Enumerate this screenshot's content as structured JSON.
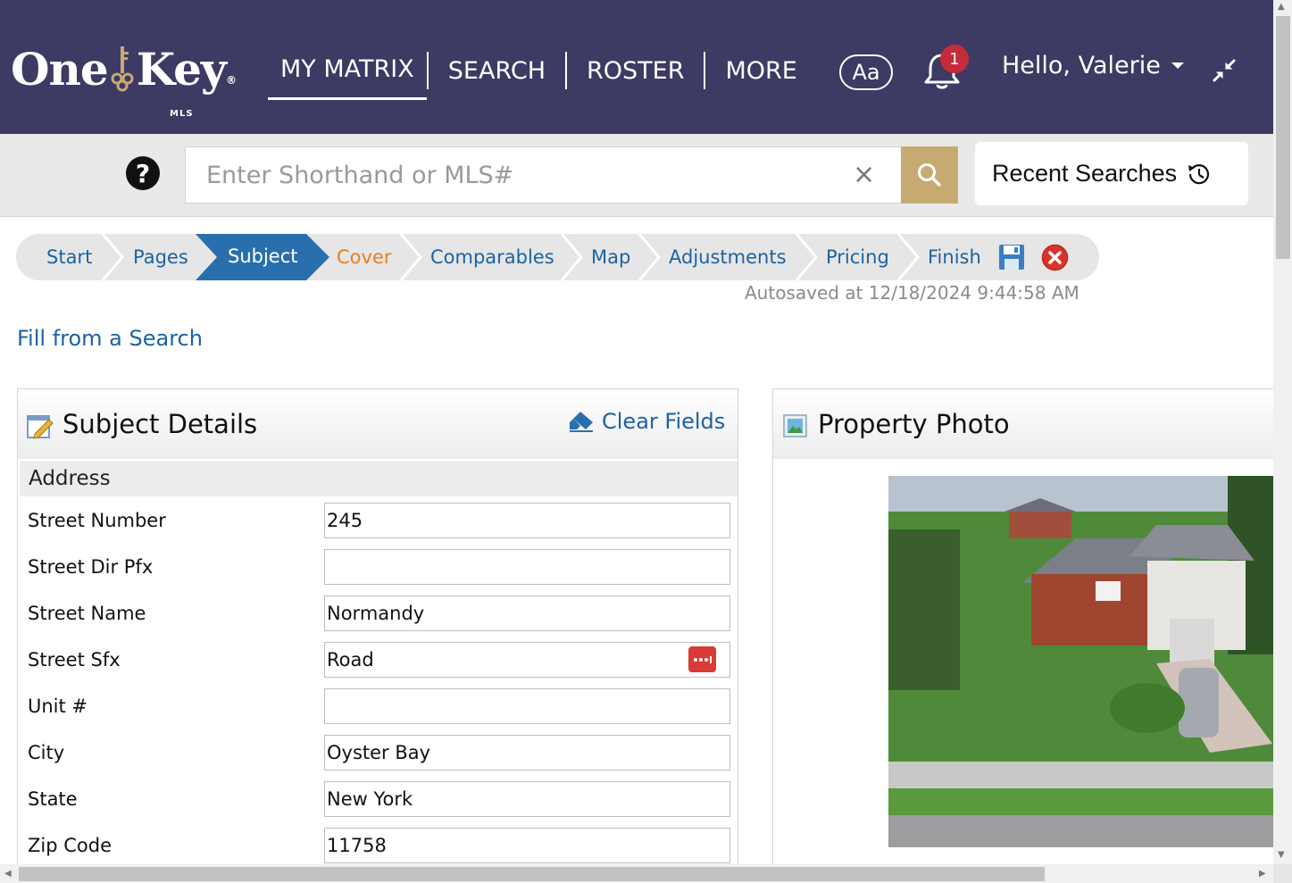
{
  "header": {
    "logo": {
      "word1": "One",
      "word2": "Key",
      "reg": "®",
      "sub": "MLS"
    },
    "nav": [
      "MY MATRIX",
      "SEARCH",
      "ROSTER",
      "MORE"
    ],
    "active_nav": "MY MATRIX",
    "font_button": "Aa",
    "notification_count": "1",
    "greeting": "Hello, Valerie",
    "colors": {
      "bar": "#3d3a63",
      "badge": "#c62b3a"
    }
  },
  "search": {
    "placeholder": "Enter Shorthand or MLS#",
    "value": "",
    "clear_glyph": "×",
    "recent_label": "Recent Searches",
    "button_color": "#c6aa72"
  },
  "wizard": {
    "steps": [
      "Start",
      "Pages",
      "Subject",
      "Cover",
      "Comparables",
      "Map",
      "Adjustments",
      "Pricing",
      "Finish"
    ],
    "active": "Subject",
    "autosave": "Autosaved at 12/18/2024 9:44:58 AM",
    "active_color": "#2a6fad",
    "cover_color": "#e7801f"
  },
  "fill_link": "Fill from a Search",
  "subject": {
    "title": "Subject Details",
    "clear_fields": "Clear Fields",
    "section": "Address",
    "fields": [
      {
        "label": "Street Number",
        "value": "245"
      },
      {
        "label": "Street Dir Pfx",
        "value": ""
      },
      {
        "label": "Street Name",
        "value": "Normandy"
      },
      {
        "label": "Street Sfx",
        "value": "Road"
      },
      {
        "label": "Unit #",
        "value": ""
      },
      {
        "label": "City",
        "value": "Oyster Bay"
      },
      {
        "label": "State",
        "value": "New York"
      },
      {
        "label": "Zip Code",
        "value": "11758"
      }
    ]
  },
  "photo_panel": {
    "title": "Property Photo"
  }
}
